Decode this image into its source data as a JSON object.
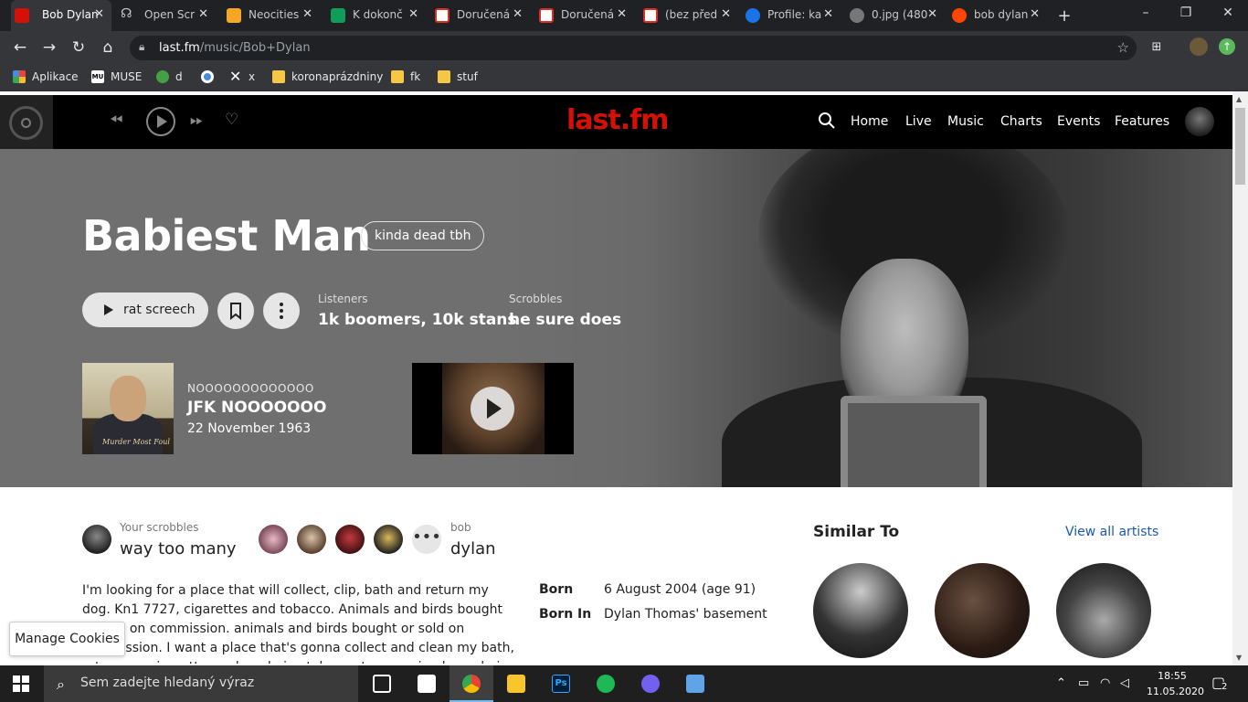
{
  "browser": {
    "tabs": [
      {
        "title": "Bob Dylan",
        "favicon_color": "#d51007",
        "active": true
      },
      {
        "title": "Open Scr",
        "favicon_color": "#9aa0a6"
      },
      {
        "title": "Neocities",
        "favicon_color": "#f5a623"
      },
      {
        "title": "K dokonč",
        "favicon_color": "#0f9d58"
      },
      {
        "title": "Doručená",
        "favicon_color": "#d93025"
      },
      {
        "title": "Doručená",
        "favicon_color": "#d93025"
      },
      {
        "title": "(bez před",
        "favicon_color": "#d93025"
      },
      {
        "title": "Profile: ka",
        "favicon_color": "#1a73e8"
      },
      {
        "title": "0.jpg (480",
        "favicon_color": "#777777"
      },
      {
        "title": "bob dylan",
        "favicon_color": "#ff4500"
      }
    ],
    "url_host": "last.fm",
    "url_path": "/music/Bob+Dylan",
    "bookmarks": [
      {
        "label": "Aplikace",
        "icon": "apps-grid-icon",
        "color": "#e8453c"
      },
      {
        "label": "MUSE",
        "icon": "muse-icon",
        "color": "#ffffff"
      },
      {
        "label": "d",
        "icon": "people-icon",
        "color": "#43a047"
      },
      {
        "label": "",
        "icon": "circle-logo-icon",
        "color": "#4a8bdc"
      },
      {
        "label": "x",
        "icon": "x-logo-icon",
        "color": "#ffffff"
      },
      {
        "label": "koronaprázdniny",
        "icon": "folder-icon",
        "color": "#f6c744"
      },
      {
        "label": "fk",
        "icon": "folder-icon",
        "color": "#f6c744"
      },
      {
        "label": "stuf",
        "icon": "folder-icon",
        "color": "#f6c744"
      }
    ]
  },
  "lastfm": {
    "logo": "last.fm",
    "nav": [
      "Home",
      "Live",
      "Music",
      "Charts",
      "Events",
      "Features"
    ],
    "artist_name": "Babiest Man",
    "tag": "kinda dead tbh",
    "play_label": "rat screech",
    "stats": [
      {
        "label": "Listeners",
        "value": "1k boomers, 10k stans"
      },
      {
        "label": "Scrobbles",
        "value": "he sure does"
      }
    ],
    "featured": {
      "small": "NOOOOOOOOOOOOO",
      "title": "JFK NOOOOOOO",
      "date": "22 November 1963",
      "image_caption": "Murder Most Foul"
    },
    "your_scrobbles_label": "Your scrobbles",
    "your_scrobbles_value": "way too many",
    "friend_label": "bob",
    "friend_value": "dylan",
    "bio": "I'm looking for a place that will collect, clip, bath and return my dog. Kn1 7727, cigarettes and tobacco. Animals and birds bought or sold on commission. animals and birds bought or sold on commission. I want a place that's gonna collect and clean my bath, return my cigarette, and, and give tobacco to my animals, and give my birds a commission. I",
    "facts": [
      {
        "key": "Born",
        "value": "6 August 2004 (age 91)"
      },
      {
        "key": "Born In",
        "value": "Dylan Thomas' basement"
      }
    ],
    "similar_title": "Similar To",
    "similar_link": "View all artists"
  },
  "overlay": {
    "cookies": "Manage Cookies"
  },
  "taskbar": {
    "search_placeholder": "Sem zadejte hledaný výraz",
    "apps": [
      {
        "name": "task-view",
        "color": "#ffffff"
      },
      {
        "name": "files",
        "color": "#ffffff"
      },
      {
        "name": "chrome",
        "color": "#4285f4",
        "active": true
      },
      {
        "name": "explorer",
        "color": "#f8c62c"
      },
      {
        "name": "photoshop",
        "color": "#31a8ff"
      },
      {
        "name": "spotify",
        "color": "#1db954"
      },
      {
        "name": "viber",
        "color": "#7360f2"
      },
      {
        "name": "notepad",
        "color": "#5ea4e6"
      }
    ],
    "time": "18:55",
    "date": "11.05.2020",
    "notifications": "2"
  },
  "colors": {
    "lastfm_red": "#d51007",
    "link_blue": "#1a5aab"
  }
}
